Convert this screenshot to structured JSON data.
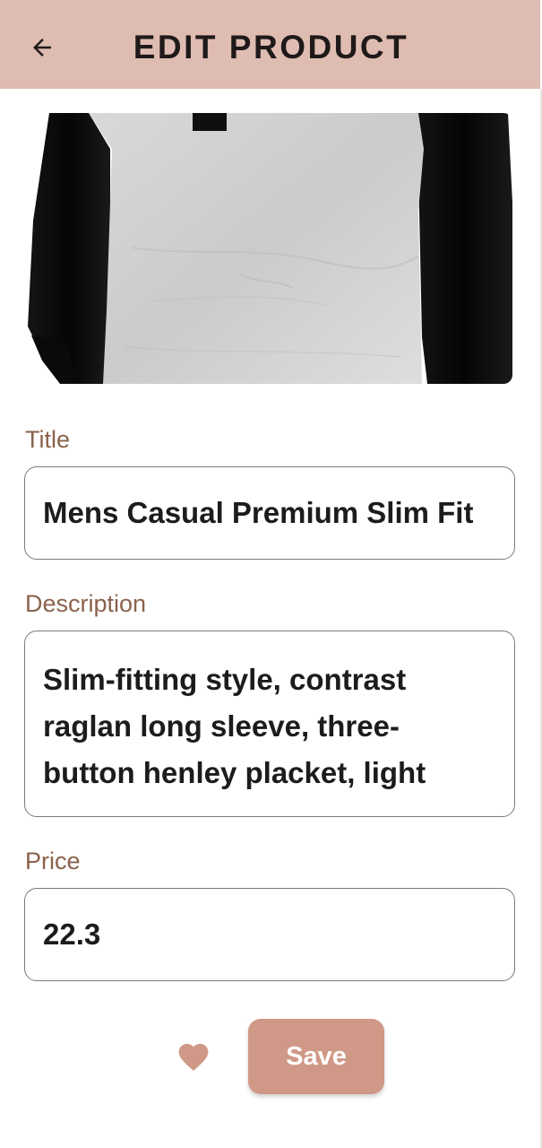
{
  "header": {
    "title": "EDIT PRODUCT",
    "back_icon": "arrow-back-icon",
    "background": "#dfbcb1"
  },
  "product_image": {
    "alt": "Mens Casual Premium Slim Fit"
  },
  "form": {
    "title": {
      "label": "Title",
      "value": "Mens Casual Premium Slim Fit"
    },
    "description": {
      "label": "Description",
      "lines": [
        "Slim-fitting style, contrast",
        "raglan long sleeve, three-",
        "button henley placket, light"
      ]
    },
    "price": {
      "label": "Price",
      "value": "22.3"
    }
  },
  "actions": {
    "favorite_icon": "heart-icon",
    "save_label": "Save"
  },
  "colors": {
    "accent": "#d09886",
    "label": "#8a624c",
    "heart": "#d09886"
  }
}
